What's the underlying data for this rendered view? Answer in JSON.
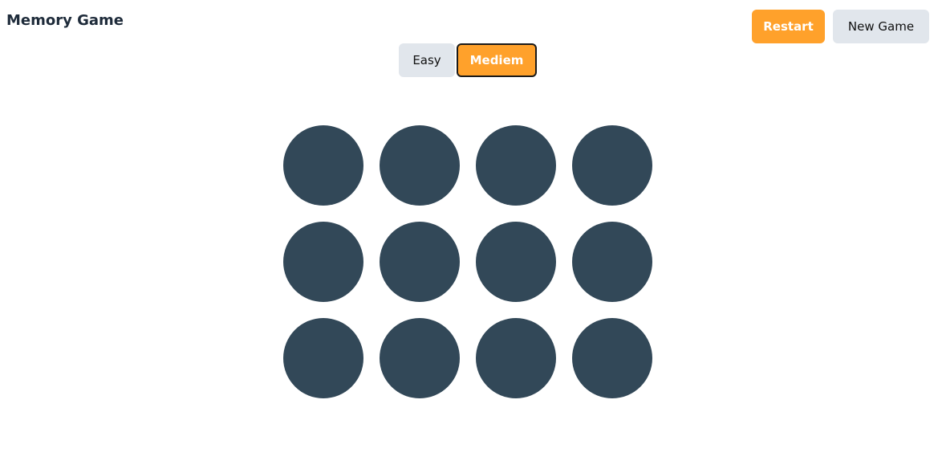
{
  "header": {
    "title": "Memory Game",
    "restart_label": "Restart",
    "new_game_label": "New Game"
  },
  "difficulty": {
    "options": [
      "Easy",
      "Mediem"
    ],
    "selected": "Mediem"
  },
  "board": {
    "rows": 3,
    "columns": 4,
    "cards_face_down": 12
  },
  "colors": {
    "accent": "#ffa12b",
    "card_back": "#324858",
    "secondary_button": "#e1e6ec",
    "title": "#1e2b3a"
  }
}
